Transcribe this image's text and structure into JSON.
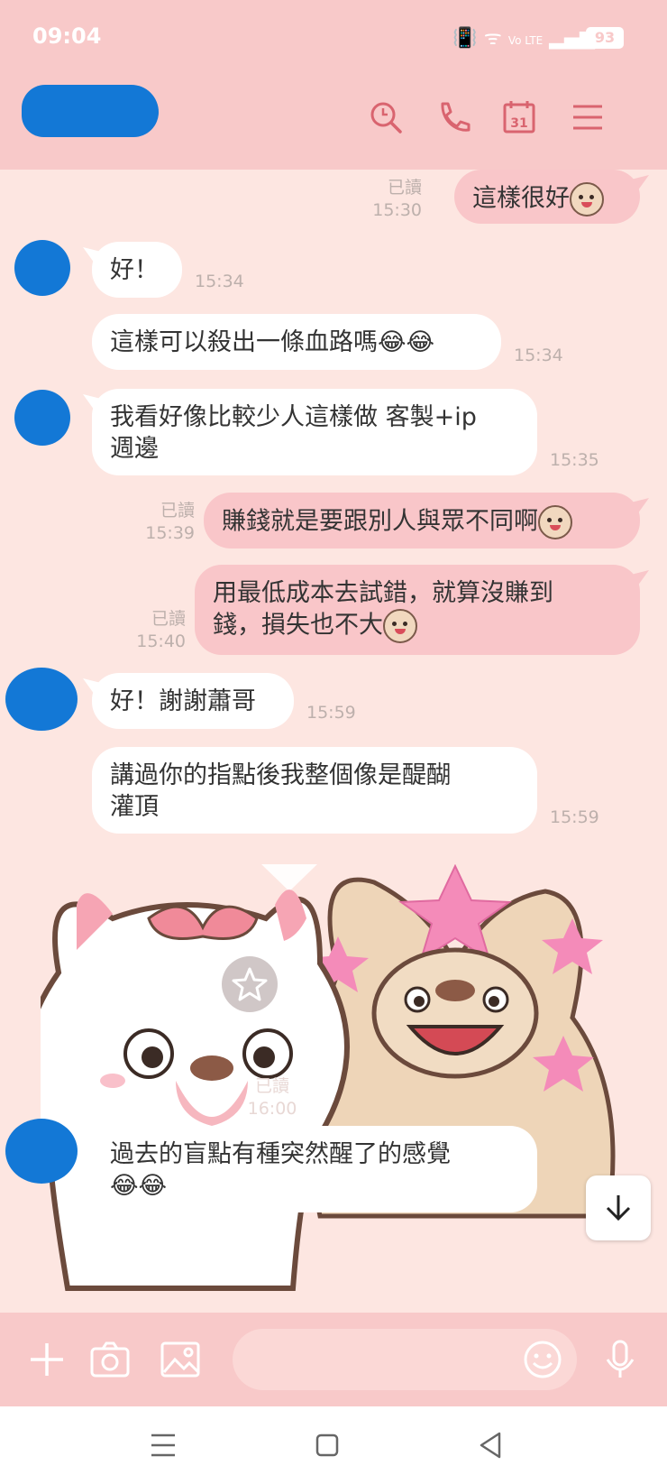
{
  "status_bar": {
    "time": "09:04",
    "network": "Vo LTE",
    "battery": "93"
  },
  "header": {
    "contact_name": ""
  },
  "messages": [
    {
      "text": "這樣很好",
      "read": "已讀",
      "time": "15:30"
    },
    {
      "text": "好！",
      "time": "15:34"
    },
    {
      "text": "這樣可以殺出一條血路嗎😂😂",
      "time": "15:34"
    },
    {
      "text": "我看好像比較少人這樣做 客製+ip週邊",
      "line1": "我看好像比較少人這樣做 客製+ip",
      "line2": "週邊",
      "time": "15:35"
    },
    {
      "text": "賺錢就是要跟別人與眾不同啊",
      "read": "已讀",
      "time": "15:39"
    },
    {
      "text": "用最低成本去試錯，就算沒賺到錢，損失也不大",
      "line1": "用最低成本去試錯，就算沒賺到",
      "line2": "錢，損失也不大",
      "read": "已讀",
      "time": "15:40"
    },
    {
      "text": "好！謝謝蕭哥",
      "time": "15:59"
    },
    {
      "text": "講過你的指點後我整個像是醍醐灌頂",
      "line1": "講過你的指點後我整個像是醍醐",
      "line2": "灌頂",
      "time": "15:59"
    },
    {
      "kind": "sticker",
      "read": "已讀",
      "time": "16:00"
    },
    {
      "text": "過去的盲點有種突然醒了的感覺😂😂",
      "line1": "過去的盲點有種突然醒了的感覺",
      "line2": "😂😂"
    }
  ],
  "composer": {
    "placeholder": ""
  },
  "colors": {
    "header_bg": "#f8c9c9",
    "chat_bg": "#fde6e1",
    "outgoing_bubble": "#f9c6c9",
    "incoming_bubble": "#ffffff",
    "icon_accent": "#d9646f"
  },
  "icons": [
    "search-icon",
    "phone-icon",
    "calendar-icon",
    "menu-icon",
    "plus-icon",
    "camera-icon",
    "image-icon",
    "emoji-icon",
    "mic-icon",
    "scroll-down-icon",
    "star-icon"
  ]
}
